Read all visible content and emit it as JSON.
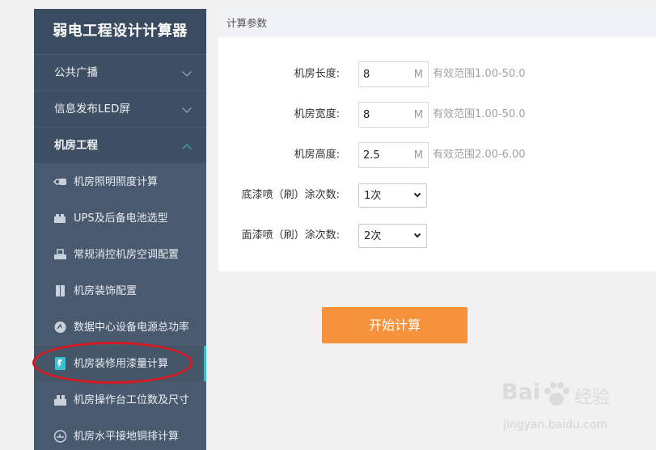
{
  "sidebar": {
    "title": "弱电工程设计计算器",
    "groups": [
      {
        "label": "公共广播"
      },
      {
        "label": "信息发布LED屏"
      },
      {
        "label": "机房工程"
      }
    ],
    "sub_items": [
      {
        "label": "机房照明照度计算",
        "icon": "lighting-icon"
      },
      {
        "label": "UPS及后备电池选型",
        "icon": "ups-battery-icon"
      },
      {
        "label": "常规消控机房空调配置",
        "icon": "air-conditioner-icon"
      },
      {
        "label": "机房装饰配置",
        "icon": "decoration-icon"
      },
      {
        "label": "数据中心设备电源总功率",
        "icon": "power-gauge-icon"
      },
      {
        "label": "机房装修用漆量计算",
        "icon": "paint-document-icon"
      },
      {
        "label": "机房操作台工位数及尺寸",
        "icon": "console-desk-icon"
      },
      {
        "label": "机房水平接地铜排计算",
        "icon": "grounding-icon"
      }
    ]
  },
  "panel": {
    "header": "计算参数",
    "fields": [
      {
        "label": "机房长度:",
        "value": "8",
        "unit": "M",
        "hint": "有效范围1.00-50.0"
      },
      {
        "label": "机房宽度:",
        "value": "8",
        "unit": "M",
        "hint": "有效范围1.00-50.0"
      },
      {
        "label": "机房高度:",
        "value": "2.5",
        "unit": "M",
        "hint": "有效范围2.00-6.00"
      }
    ],
    "selects": [
      {
        "label": "底漆喷（刷）涂次数:",
        "value": "1次"
      },
      {
        "label": "面漆喷（刷）涂次数:",
        "value": "2次"
      }
    ]
  },
  "actions": {
    "calculate": "开始计算"
  },
  "watermark": {
    "brand": "Bai",
    "brand_suffix": "经验",
    "url": "jingyan.baidu.com"
  },
  "colors": {
    "sidebar_bg": "#3b4b5f",
    "accent": "#39bcd0",
    "button": "#f7923c",
    "highlight": "#d61820"
  }
}
